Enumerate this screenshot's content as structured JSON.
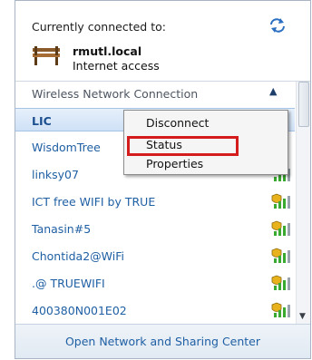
{
  "header": {
    "connected_label": "Currently connected to:",
    "network_name": "rmutl.local",
    "network_status": "Internet access"
  },
  "section": {
    "label": "Wireless Network Connection"
  },
  "networks": [
    {
      "name": "LIC",
      "selected": true,
      "secured": false
    },
    {
      "name": "WisdomTree",
      "selected": false,
      "secured": false
    },
    {
      "name": "linksy07",
      "selected": false,
      "secured": false
    },
    {
      "name": "ICT free WIFI by TRUE",
      "selected": false,
      "secured": true
    },
    {
      "name": "Tanasin#5",
      "selected": false,
      "secured": true
    },
    {
      "name": "Chontida2@WiFi",
      "selected": false,
      "secured": true
    },
    {
      "name": ".@ TRUEWIFI",
      "selected": false,
      "secured": true
    },
    {
      "name": "400380N001E02",
      "selected": false,
      "secured": true
    }
  ],
  "context_menu": {
    "disconnect": "Disconnect",
    "status": "Status",
    "properties": "Properties"
  },
  "footer": {
    "link": "Open Network and Sharing Center"
  },
  "colors": {
    "link": "#1f5fa3",
    "highlight_border": "#d41c1c",
    "signal_green": "#3aa92f",
    "shield_yellow": "#e7b21b"
  }
}
